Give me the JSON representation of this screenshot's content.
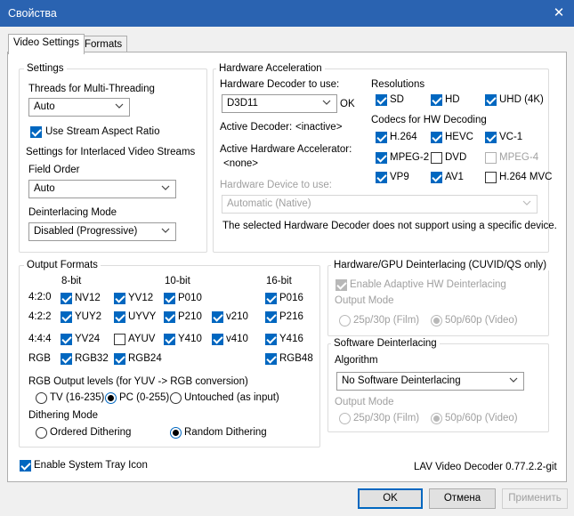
{
  "window": {
    "title": "Свойства",
    "close_glyph": "✕"
  },
  "tabs": [
    "Video Settings",
    "Formats"
  ],
  "settings": {
    "legend": "Settings",
    "threads_label": "Threads for Multi-Threading",
    "threads_value": "Auto",
    "stream_aspect_label": "Use Stream Aspect Ratio",
    "stream_aspect_checked": true,
    "interlaced_label": "Settings for Interlaced Video Streams",
    "field_order_label": "Field Order",
    "field_order_value": "Auto",
    "deint_mode_label": "Deinterlacing Mode",
    "deint_mode_value": "Disabled (Progressive)"
  },
  "hwaccel": {
    "legend": "Hardware Acceleration",
    "decoder_label": "Hardware Decoder to use:",
    "decoder_value": "D3D11",
    "decoder_status": "OK",
    "active_decoder_label": "Active Decoder:",
    "active_decoder_value": "<inactive>",
    "active_accel_label": "Active Hardware Accelerator:",
    "active_accel_value": "<none>",
    "device_label": "Hardware Device to use:",
    "device_value": "Automatic (Native)",
    "note": "The selected Hardware Decoder does not support using a specific device.",
    "resolutions_label": "Resolutions",
    "resolutions": [
      {
        "label": "SD",
        "checked": true,
        "disabled": false
      },
      {
        "label": "HD",
        "checked": true,
        "disabled": false
      },
      {
        "label": "UHD (4K)",
        "checked": true,
        "disabled": false
      }
    ],
    "codecs_label": "Codecs for HW Decoding",
    "codecs": [
      {
        "label": "H.264",
        "checked": true,
        "disabled": false
      },
      {
        "label": "HEVC",
        "checked": true,
        "disabled": false
      },
      {
        "label": "VC-1",
        "checked": true,
        "disabled": false
      },
      {
        "label": "MPEG-2",
        "checked": true,
        "disabled": false
      },
      {
        "label": "DVD",
        "checked": false,
        "disabled": false
      },
      {
        "label": "MPEG-4",
        "checked": false,
        "disabled": true
      },
      {
        "label": "VP9",
        "checked": true,
        "disabled": false
      },
      {
        "label": "AV1",
        "checked": true,
        "disabled": false
      },
      {
        "label": "H.264 MVC",
        "checked": false,
        "disabled": false
      }
    ]
  },
  "output": {
    "legend": "Output Formats",
    "col_headers": [
      "8-bit",
      "10-bit",
      "16-bit"
    ],
    "row_labels": [
      "4:2:0",
      "4:2:2",
      "4:4:4",
      "RGB"
    ],
    "formats": [
      {
        "label": "NV12",
        "checked": true
      },
      {
        "label": "YV12",
        "checked": true
      },
      {
        "label": "P010",
        "checked": true
      },
      {
        "label": "P016",
        "checked": true
      },
      {
        "label": "YUY2",
        "checked": true
      },
      {
        "label": "UYVY",
        "checked": true
      },
      {
        "label": "P210",
        "checked": true
      },
      {
        "label": "v210",
        "checked": true
      },
      {
        "label": "P216",
        "checked": true
      },
      {
        "label": "YV24",
        "checked": true
      },
      {
        "label": "AYUV",
        "checked": false
      },
      {
        "label": "Y410",
        "checked": true
      },
      {
        "label": "v410",
        "checked": true
      },
      {
        "label": "Y416",
        "checked": true
      },
      {
        "label": "RGB32",
        "checked": true
      },
      {
        "label": "RGB24",
        "checked": true
      },
      {
        "label": "RGB48",
        "checked": true
      }
    ],
    "rgb_levels_label": "RGB Output levels (for YUV -> RGB conversion)",
    "rgb_levels": [
      {
        "label": "TV (16-235)",
        "selected": false
      },
      {
        "label": "PC (0-255)",
        "selected": true
      },
      {
        "label": "Untouched (as input)",
        "selected": false
      }
    ],
    "dithering_label": "Dithering Mode",
    "dithering": [
      {
        "label": "Ordered Dithering",
        "selected": false
      },
      {
        "label": "Random Dithering",
        "selected": true
      }
    ]
  },
  "hwdeint": {
    "legend": "Hardware/GPU Deinterlacing (CUVID/QS only)",
    "adaptive_label": "Enable Adaptive HW Deinterlacing",
    "adaptive_checked": true,
    "output_mode_label": "Output Mode",
    "modes": [
      {
        "label": "25p/30p (Film)",
        "selected": false
      },
      {
        "label": "50p/60p (Video)",
        "selected": true
      }
    ]
  },
  "swdeint": {
    "legend": "Software Deinterlacing",
    "algorithm_label": "Algorithm",
    "algorithm_value": "No Software Deinterlacing",
    "output_mode_label": "Output Mode",
    "modes": [
      {
        "label": "25p/30p (Film)",
        "selected": false
      },
      {
        "label": "50p/60p (Video)",
        "selected": true
      }
    ]
  },
  "tray_label": "Enable System Tray Icon",
  "tray_checked": true,
  "version": "LAV Video Decoder 0.77.2.2-git",
  "buttons": {
    "ok": "OK",
    "cancel": "Отмена",
    "apply": "Применить"
  },
  "colors": {
    "titlebar": "#2a63b1",
    "accent": "#0067c0"
  }
}
